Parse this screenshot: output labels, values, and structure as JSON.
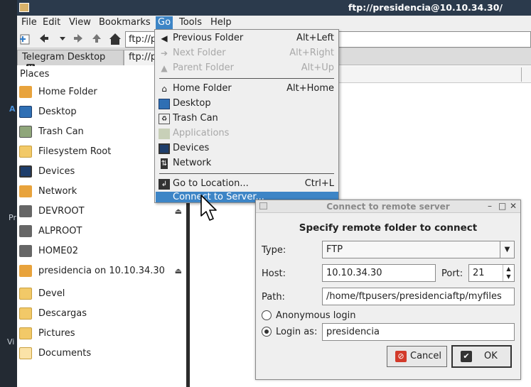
{
  "window": {
    "title": "ftp://presidencia@10.10.34.30/"
  },
  "desktop_fragments": [
    "A",
    "Pr",
    "Vi"
  ],
  "menubar": [
    "File",
    "Edit",
    "View",
    "Bookmarks",
    "Go",
    "Tools",
    "Help"
  ],
  "toolbar": {
    "address": "ftp://presidencia@10.10.34.30/",
    "icons": [
      "new-tab-icon",
      "back-icon",
      "history-down-icon",
      "forward-icon",
      "up-icon",
      "home-icon"
    ]
  },
  "tabs": [
    {
      "label": "Telegram Desktop"
    },
    {
      "label": "ftp://presidencia@10.10.34.30/"
    }
  ],
  "sidebar": {
    "heading": "Places",
    "items": [
      {
        "label": "Home Folder",
        "icon": "home-folder-icon",
        "color": "#e8a33c"
      },
      {
        "label": "Desktop",
        "icon": "desktop-icon",
        "color": "#2f6fb4"
      },
      {
        "label": "Trash Can",
        "icon": "trash-icon",
        "color": "#8fa67a"
      },
      {
        "label": "Filesystem Root",
        "icon": "folder-icon",
        "color": "#f2c968"
      },
      {
        "label": "Devices",
        "icon": "monitor-icon",
        "color": "#1d3d6b"
      },
      {
        "label": "Network",
        "icon": "rss-icon",
        "color": "#e8a33c"
      },
      {
        "label": "DEVROOT",
        "icon": "drive-icon",
        "color": "#666666",
        "eject": true
      },
      {
        "label": "ALPROOT",
        "icon": "drive-icon",
        "color": "#666666"
      },
      {
        "label": "HOME02",
        "icon": "drive-icon",
        "color": "#666666"
      },
      {
        "label": "presidencia on 10.10.34.30",
        "icon": "rss-icon",
        "color": "#e8a33c",
        "eject": true
      },
      {
        "label": "Devel",
        "icon": "folder-icon",
        "color": "#f2c968"
      },
      {
        "label": "Descargas",
        "icon": "download-folder-icon",
        "color": "#e8a33c"
      },
      {
        "label": "Pictures",
        "icon": "pictures-folder-icon",
        "color": "#e8a33c"
      },
      {
        "label": "Documents",
        "icon": "documents-folder-icon",
        "color": "#f2c968"
      }
    ]
  },
  "go_menu": {
    "items": [
      {
        "label": "Previous Folder",
        "shortcut": "Alt+Left",
        "icon": "back-arrow-icon",
        "enabled": true
      },
      {
        "label": "Next Folder",
        "shortcut": "Alt+Right",
        "icon": "forward-arrow-icon",
        "enabled": false
      },
      {
        "label": "Parent Folder",
        "shortcut": "Alt+Up",
        "icon": "up-arrow-icon",
        "enabled": false
      },
      {
        "label": "Home Folder",
        "shortcut": "Alt+Home",
        "icon": "home-icon",
        "enabled": true
      },
      {
        "label": "Desktop",
        "shortcut": "",
        "icon": "desktop-icon",
        "enabled": true
      },
      {
        "label": "Trash Can",
        "shortcut": "",
        "icon": "trash-icon",
        "enabled": true
      },
      {
        "label": "Applications",
        "shortcut": "",
        "icon": "applications-icon",
        "enabled": false
      },
      {
        "label": "Devices",
        "shortcut": "",
        "icon": "monitor-icon",
        "enabled": true
      },
      {
        "label": "Network",
        "shortcut": "",
        "icon": "network-icon",
        "enabled": true
      },
      {
        "label": "Go to Location...",
        "shortcut": "Ctrl+L",
        "icon": "location-icon",
        "enabled": true
      },
      {
        "label": "Connect to Server...",
        "shortcut": "",
        "icon": "",
        "enabled": true,
        "highlighted": true
      }
    ]
  },
  "dialog": {
    "title": "Connect to remote server",
    "heading": "Specify remote folder to connect",
    "type_label": "Type:",
    "type_value": "FTP",
    "host_label": "Host:",
    "host_value": "10.10.34.30",
    "port_label": "Port:",
    "port_value": "21",
    "path_label": "Path:",
    "path_value": "/home/ftpusers/presidenciaftp/myfiles",
    "anon_label": "Anonymous login",
    "anon_selected": false,
    "login_label": "Login as:",
    "login_selected": true,
    "login_value": "presidencia",
    "cancel_label": "Cancel",
    "ok_label": "OK"
  },
  "colors": {
    "accent": "#3d85c6",
    "titlebar": "#2b3a4c",
    "cancel_icon": "#d23a2a",
    "ok_icon": "#333333"
  }
}
